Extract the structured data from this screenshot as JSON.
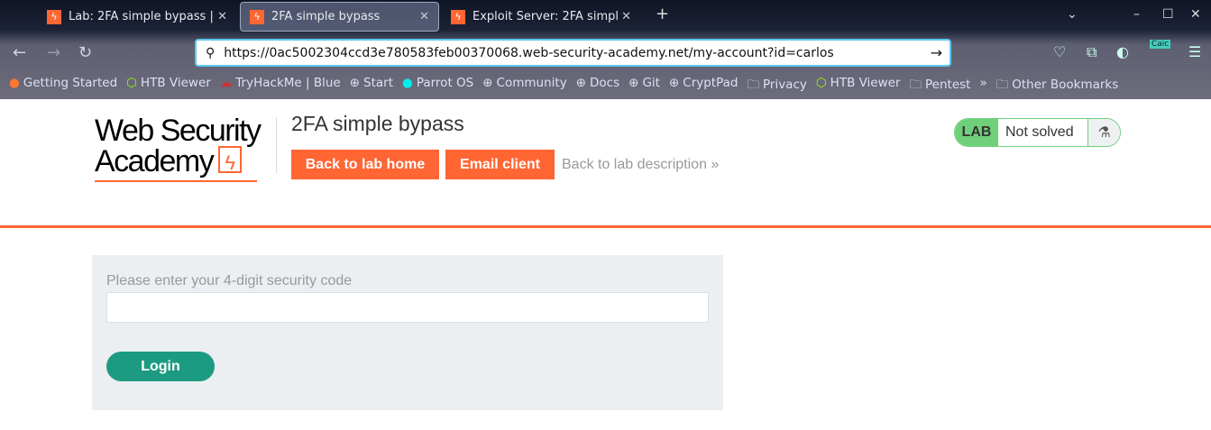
{
  "browser": {
    "tabs": [
      {
        "label": "Lab: 2FA simple bypass |"
      },
      {
        "label": "2FA simple bypass"
      },
      {
        "label": "Exploit Server: 2FA simpl"
      }
    ],
    "url": "https://0ac5002304ccd3e780583feb00370068.web-security-academy.net/my-account?id=carlos",
    "extension_badge": "Caic",
    "bookmarks": [
      "Getting Started",
      "HTB Viewer",
      "TryHackMe | Blue",
      "Start",
      "Parrot OS",
      "Community",
      "Docs",
      "Git",
      "CryptPad",
      "Privacy",
      "HTB Viewer",
      "Pentest",
      "Other Bookmarks"
    ]
  },
  "header": {
    "logo_line1": "Web Security",
    "logo_line2": "Academy",
    "title": "2FA simple bypass",
    "back_home": "Back to lab home",
    "email_client": "Email client",
    "back_desc": "Back to lab description",
    "lab_label": "LAB",
    "lab_status": "Not solved"
  },
  "form": {
    "label": "Please enter your 4-digit security code",
    "value": "",
    "login": "Login"
  },
  "colors": {
    "accent": "#ff6633",
    "login": "#1c9b82",
    "lab": "#70d07a"
  }
}
